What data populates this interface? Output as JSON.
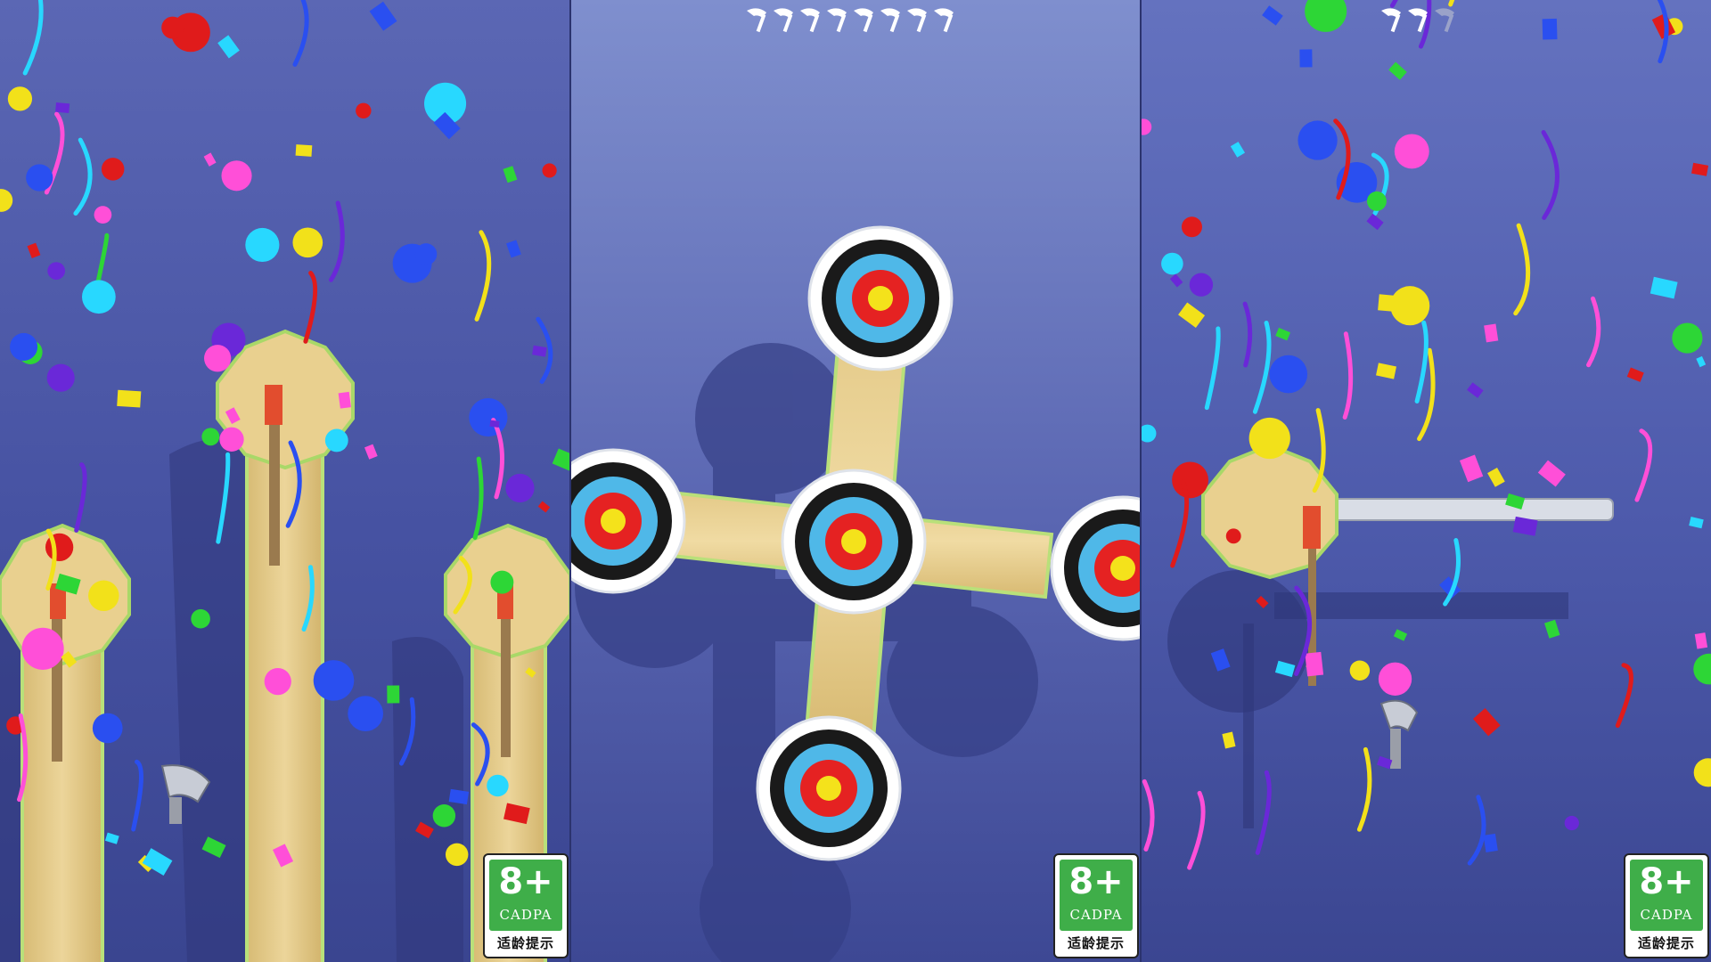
{
  "panels": [
    {
      "id": "level-complete-left",
      "age_rating": {
        "age": "8+",
        "org": "CADPA",
        "tip": "适龄提示"
      }
    },
    {
      "id": "spinning-target-middle",
      "axes_remaining": 8,
      "age_rating": {
        "age": "8+",
        "org": "CADPA",
        "tip": "适龄提示"
      }
    },
    {
      "id": "level-complete-right",
      "axes_remaining": 3,
      "axes_used": 1,
      "age_rating": {
        "age": "8+",
        "org": "CADPA",
        "tip": "适龄提示"
      }
    }
  ],
  "colors": {
    "wood": "#e6cc8a",
    "wood_edge": "#b9e07a",
    "target_outer": "#1a1a1a",
    "target_mid": "#4fb8e8",
    "target_red": "#e52222",
    "target_center": "#f4e21b",
    "confetti": [
      "#e01b1b",
      "#6a28d8",
      "#2a4ff0",
      "#f2e11a",
      "#2dd636",
      "#ff4fd8",
      "#28d8ff"
    ]
  }
}
